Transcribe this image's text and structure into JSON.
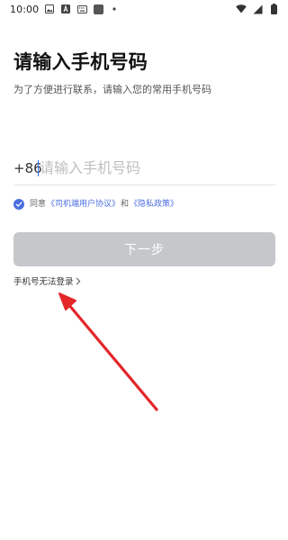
{
  "status_bar": {
    "time": "10:00",
    "left_icons": [
      "gallery-icon",
      "text-a-icon",
      "keyboard-icon",
      "app-square-icon",
      "dot-icon"
    ],
    "right_icons": [
      "signal-icon",
      "wifi-icon",
      "battery-icon"
    ]
  },
  "header": {
    "title": "请输入手机号码",
    "subtitle": "为了方便进行联系，请输入您的常用手机号码"
  },
  "phone": {
    "country_code": "+86",
    "value": "",
    "placeholder": "请输入手机号码"
  },
  "agreement": {
    "checked": true,
    "prefix": "同意",
    "link1": "《司机端用户协议》",
    "connector": "和",
    "link2": "《隐私政策》"
  },
  "next_button": {
    "label": "下一步",
    "enabled": false
  },
  "cannot_login": {
    "label": "手机号无法登录"
  },
  "colors": {
    "accent": "#4b6fe0",
    "button_disabled": "#c6c7cb",
    "annotation_arrow": "#e3262a"
  }
}
